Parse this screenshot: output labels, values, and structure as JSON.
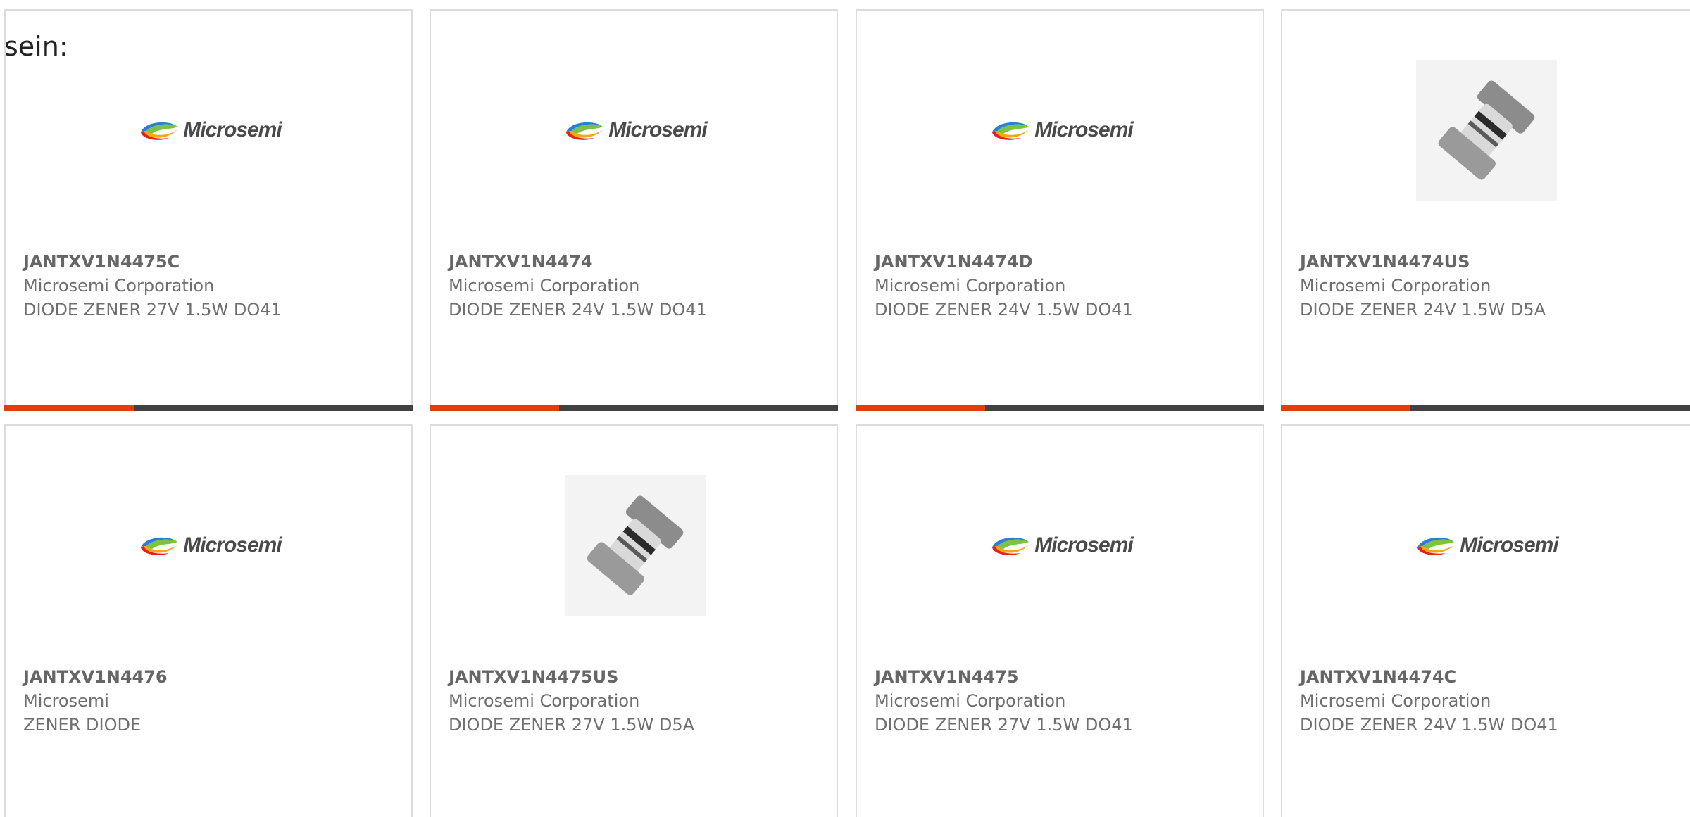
{
  "intro_text": "sein:",
  "products": [
    {
      "part": "JANTXV1N4475C",
      "manufacturer": "Microsemi Corporation",
      "description": "DIODE ZENER 27V 1.5W DO41",
      "image": "microsemi-logo",
      "logo_text": "Microsemi"
    },
    {
      "part": "JANTXV1N4474",
      "manufacturer": "Microsemi Corporation",
      "description": "DIODE ZENER 24V 1.5W DO41",
      "image": "microsemi-logo",
      "logo_text": "Microsemi"
    },
    {
      "part": "JANTXV1N4474D",
      "manufacturer": "Microsemi Corporation",
      "description": "DIODE ZENER 24V 1.5W DO41",
      "image": "microsemi-logo",
      "logo_text": "Microsemi"
    },
    {
      "part": "JANTXV1N4474US",
      "manufacturer": "Microsemi Corporation",
      "description": "DIODE ZENER 24V 1.5W D5A",
      "image": "diode-photo"
    },
    {
      "part": "JANTXV1N4476",
      "manufacturer": "Microsemi",
      "description": "ZENER DIODE",
      "image": "microsemi-logo",
      "logo_text": "Microsemi"
    },
    {
      "part": "JANTXV1N4475US",
      "manufacturer": "Microsemi Corporation",
      "description": "DIODE ZENER 27V 1.5W D5A",
      "image": "diode-photo"
    },
    {
      "part": "JANTXV1N4475",
      "manufacturer": "Microsemi Corporation",
      "description": "DIODE ZENER 27V 1.5W DO41",
      "image": "microsemi-logo",
      "logo_text": "Microsemi"
    },
    {
      "part": "JANTXV1N4474C",
      "manufacturer": "Microsemi Corporation",
      "description": "DIODE ZENER 24V 1.5W DO41",
      "image": "microsemi-logo",
      "logo_text": "Microsemi"
    }
  ],
  "colors": {
    "accent": "#e23d0b",
    "bar": "#414141",
    "text": "#6f6f6f",
    "border": "#dcdcdc"
  }
}
